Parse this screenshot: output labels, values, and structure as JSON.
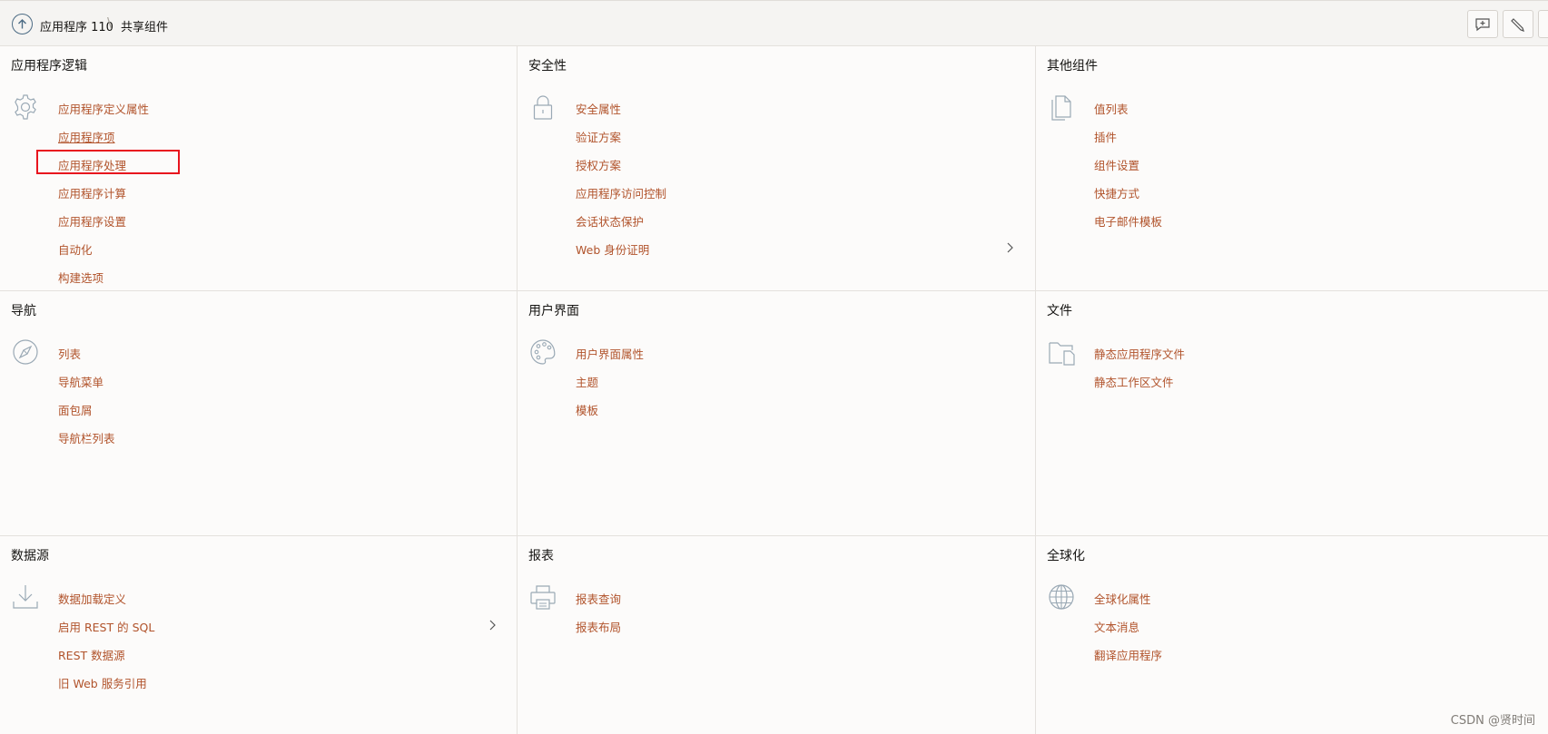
{
  "header": {
    "app_name": "应用程序 110",
    "separator": "\\",
    "current": "共享组件"
  },
  "panels": {
    "app_logic": {
      "title": "应用程序逻辑",
      "items": [
        "应用程序定义属性",
        "应用程序项",
        "应用程序处理",
        "应用程序计算",
        "应用程序设置",
        "自动化",
        "构建选项"
      ]
    },
    "security": {
      "title": "安全性",
      "items": [
        "安全属性",
        "验证方案",
        "授权方案",
        "应用程序访问控制",
        "会话状态保护",
        "Web 身份证明"
      ]
    },
    "other": {
      "title": "其他组件",
      "items": [
        "值列表",
        "插件",
        "组件设置",
        "快捷方式",
        "电子邮件模板"
      ]
    },
    "navigation": {
      "title": "导航",
      "items": [
        "列表",
        "导航菜单",
        "面包屑",
        "导航栏列表"
      ]
    },
    "ui": {
      "title": "用户界面",
      "items": [
        "用户界面属性",
        "主题",
        "模板"
      ]
    },
    "files": {
      "title": "文件",
      "items": [
        "静态应用程序文件",
        "静态工作区文件"
      ]
    },
    "data_sources": {
      "title": "数据源",
      "items": [
        "数据加载定义",
        "启用 REST 的 SQL",
        "REST 数据源",
        "旧 Web 服务引用"
      ]
    },
    "reports": {
      "title": "报表",
      "items": [
        "报表查询",
        "报表布局"
      ]
    },
    "globalization": {
      "title": "全球化",
      "items": [
        "全球化属性",
        "文本消息",
        "翻译应用程序"
      ]
    }
  },
  "watermark": "CSDN @贤时间",
  "colors": {
    "link": "#b1532b",
    "highlight": "#e8141e",
    "icon": "#9aa9b5"
  }
}
